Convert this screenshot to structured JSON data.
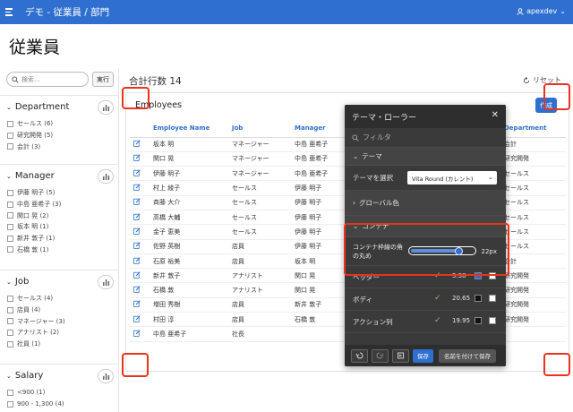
{
  "app": {
    "title": "デモ - 従業員 / 部門",
    "user": "apexdev"
  },
  "page_title": "従業員",
  "search": {
    "placeholder": "検索...",
    "go_label": "実行"
  },
  "facets": [
    {
      "title": "Department",
      "items": [
        "セールス (6)",
        "研究開発 (5)",
        "会計 (3)"
      ]
    },
    {
      "title": "Manager",
      "items": [
        "伊藤 明子 (5)",
        "中島 亜希子 (3)",
        "関口 晃 (2)",
        "坂本 明 (1)",
        "新井 敦子 (1)",
        "石橋 敦 (1)"
      ]
    },
    {
      "title": "Job",
      "items": [
        "セールス (4)",
        "店員 (4)",
        "マネージャー (3)",
        "アナリスト (2)",
        "社員 (1)"
      ]
    },
    {
      "title": "Salary",
      "items": [
        "<900 (1)",
        "900 - 1,300 (4)"
      ]
    }
  ],
  "report": {
    "total_label": "合計行数 14",
    "reset_label": "リセット",
    "title": "Employees",
    "create_label": "作成",
    "columns": [
      "Employee Name",
      "Job",
      "Manager",
      "Department"
    ],
    "rows": [
      [
        "坂本 明",
        "マネージャー",
        "中島 亜希子",
        "会計"
      ],
      [
        "関口 晃",
        "マネージャー",
        "中島 亜希子",
        "研究開発"
      ],
      [
        "伊藤 明子",
        "マネージャー",
        "中島 亜希子",
        "セールス"
      ],
      [
        "村上 綾子",
        "セールス",
        "伊藤 明子",
        "セールス"
      ],
      [
        "斉藤 大介",
        "セールス",
        "伊藤 明子",
        "セールス"
      ],
      [
        "高橋 大輔",
        "セールス",
        "伊藤 明子",
        "セールス"
      ],
      [
        "金子 恵美",
        "セールス",
        "伊藤 明子",
        "セールス"
      ],
      [
        "佐野 英樹",
        "店員",
        "伊藤 明子",
        "セールス"
      ],
      [
        "石原 裕美",
        "店員",
        "坂本 明",
        "会計"
      ],
      [
        "新井 敦子",
        "アナリスト",
        "関口 晃",
        "研究開発"
      ],
      [
        "石橋 敦",
        "アナリスト",
        "関口 晃",
        "研究開発"
      ],
      [
        "増田 秀樹",
        "店員",
        "新井 敦子",
        "研究開発"
      ],
      [
        "村田 淳",
        "店員",
        "石橋 敦",
        "研究開発"
      ],
      [
        "中島 亜希子",
        "社長",
        "",
        ""
      ]
    ]
  },
  "theme_roller": {
    "title": "テーマ・ローラー",
    "filter_placeholder": "フィルタ",
    "section_theme": "テーマ",
    "select_theme_label": "テーマを選択",
    "select_theme_value": "Vita Round (カレント)",
    "section_global_colors": "グローバル色",
    "section_container": "コンテナ",
    "radius_label": "コンテナ枠線の角の丸め",
    "radius_value": "22px",
    "radius_fraction": 0.78,
    "contrast_rows": [
      {
        "label": "ヘッダー",
        "ratio": "5.38",
        "swatch1": "#2f6fcf",
        "swatch2": "#ffffff"
      },
      {
        "label": "ボディ",
        "ratio": "20.65",
        "swatch1": "#111111",
        "swatch2": "#ffffff"
      },
      {
        "label": "アクション列",
        "ratio": "19.95",
        "swatch1": "#111111",
        "swatch2": "#ffffff"
      }
    ],
    "save_label": "保存",
    "save_as_label": "名前を付けて保存"
  },
  "colors": {
    "accent": "#2f6fcf",
    "highlight": "#e8341c",
    "panel": "#3a3a3a"
  }
}
